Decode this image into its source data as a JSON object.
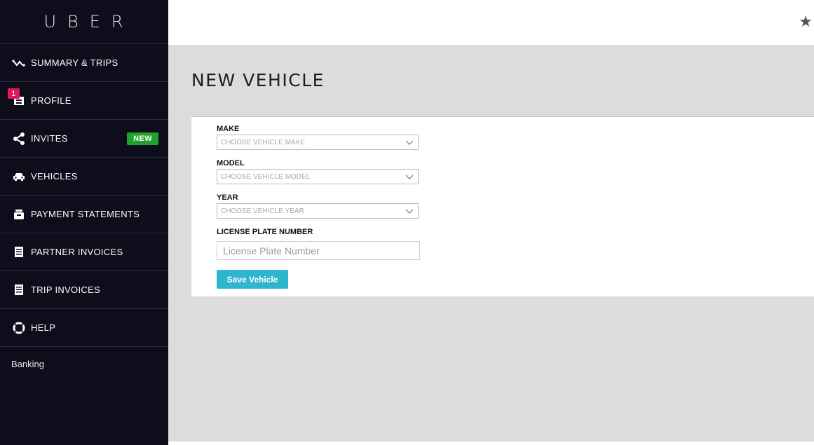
{
  "brand": {
    "logo_text": "UBER"
  },
  "sidebar": {
    "items": [
      {
        "label": "SUMMARY & TRIPS",
        "icon": "route-icon"
      },
      {
        "label": "PROFILE",
        "icon": "profile-card-icon",
        "badge_count": "1"
      },
      {
        "label": "INVITES",
        "icon": "share-icon",
        "tag": "NEW"
      },
      {
        "label": "VEHICLES",
        "icon": "car-icon"
      },
      {
        "label": "PAYMENT STATEMENTS",
        "icon": "wallet-icon"
      },
      {
        "label": "PARTNER INVOICES",
        "icon": "invoice-icon"
      },
      {
        "label": "TRIP INVOICES",
        "icon": "invoice-icon"
      },
      {
        "label": "HELP",
        "icon": "lifebuoy-icon"
      }
    ],
    "banking_label": "Banking"
  },
  "topbar": {
    "star_icon": "star-icon"
  },
  "page": {
    "title": "NEW VEHICLE"
  },
  "form": {
    "make": {
      "label": "MAKE",
      "placeholder": "CHOOSE VEHICLE MAKE"
    },
    "model": {
      "label": "MODEL",
      "placeholder": "CHOOSE VEHICLE MODEL"
    },
    "year": {
      "label": "YEAR",
      "placeholder": "CHOOSE VEHICLE YEAR"
    },
    "license": {
      "label": "LICENSE PLATE NUMBER",
      "placeholder": "License Plate Number",
      "value": ""
    },
    "save_label": "Save Vehicle"
  },
  "colors": {
    "sidebar_bg": "#0d0d1c",
    "badge_red": "#e0185a",
    "new_green": "#1fa32c",
    "button_cyan": "#2fb6cf",
    "content_bg": "#dcdcdd"
  }
}
